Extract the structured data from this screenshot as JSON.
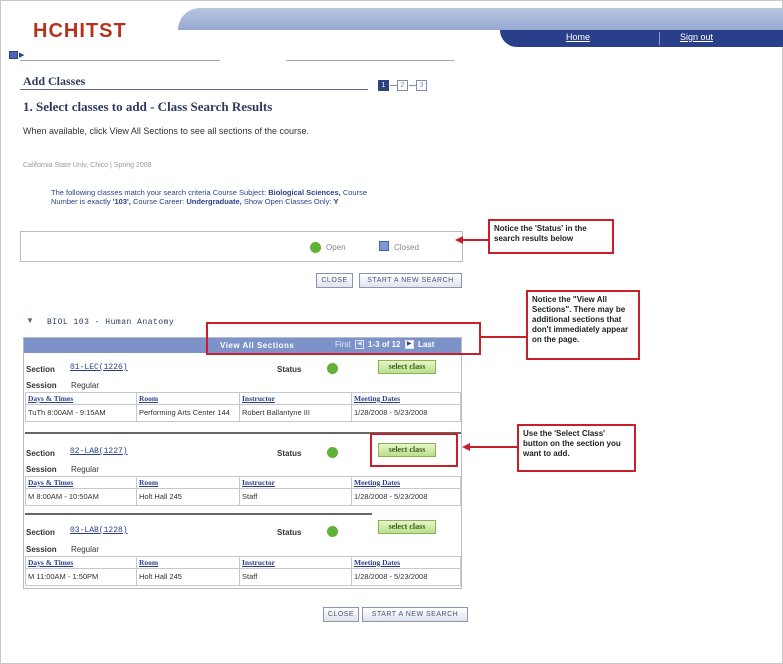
{
  "header": {
    "logo": "HCHITST",
    "nav": {
      "home": "Home",
      "sign_out": "Sign out"
    }
  },
  "page": {
    "title": "Add Classes",
    "steps": [
      "1",
      "2",
      "3"
    ],
    "subtitle": "1.  Select classes to add - Class Search Results",
    "instructions": "When available, click View All Sections to see all sections of the course.",
    "term": "California State Univ, Chico | Spring 2008",
    "criteria": {
      "prefix": "The following classes match your search criteria Course Subject:",
      "subject": "Biological Sciences,",
      "course_number_label": "Course Number is exactly",
      "course_number": "'103',",
      "career_label": "Course Career:",
      "career": "Undergraduate,",
      "open_label": "Show Open Classes Only:",
      "open_value": "Y"
    }
  },
  "legend": {
    "open": "Open",
    "closed": "Closed"
  },
  "buttons": {
    "close": "CLOSE",
    "new_search": "START A NEW SEARCH"
  },
  "course": {
    "title": "BIOL  103 - Human Anatomy",
    "view_all": "View All Sections",
    "pager_first": "First",
    "pager_range": "1-3 of 12",
    "pager_last": "Last",
    "labels": {
      "section": "Section",
      "session": "Session",
      "status": "Status",
      "select": "select class"
    },
    "columns": [
      "Days & Times",
      "Room",
      "Instructor",
      "Meeting Dates"
    ],
    "sections": [
      {
        "id": "01-LEC(1226)",
        "session": "Regular",
        "status": "Open",
        "days_times": "TuTh 8:00AM - 9:15AM",
        "room": "Performing Arts Center 144",
        "instructor": "Robert Ballantyne III",
        "dates": "1/28/2008 - 5/23/2008"
      },
      {
        "id": "02-LAB(1227)",
        "session": "Regular",
        "status": "Open",
        "days_times": "M 8:00AM - 10:50AM",
        "room": "Holt Hall 245",
        "instructor": "Staff",
        "dates": "1/28/2008 - 5/23/2008"
      },
      {
        "id": "03-LAB(1228)",
        "session": "Regular",
        "status": "Open",
        "days_times": "M 11:00AM - 1:50PM",
        "room": "Holt Hall 245",
        "instructor": "Staff",
        "dates": "1/28/2008 - 5/23/2008"
      }
    ]
  },
  "callouts": {
    "status": "Notice the 'Status' in the search results below",
    "view_all": "Notice the \"View All Sections\". There may be additional sections that don't immediately appear on the page.",
    "select": "Use the 'Select Class' button on the section you want to add."
  },
  "colors": {
    "accent_red": "#c8202a",
    "nav_blue": "#2a3f8a",
    "open_green": "#5fb138",
    "logo_red": "#b5331f"
  }
}
